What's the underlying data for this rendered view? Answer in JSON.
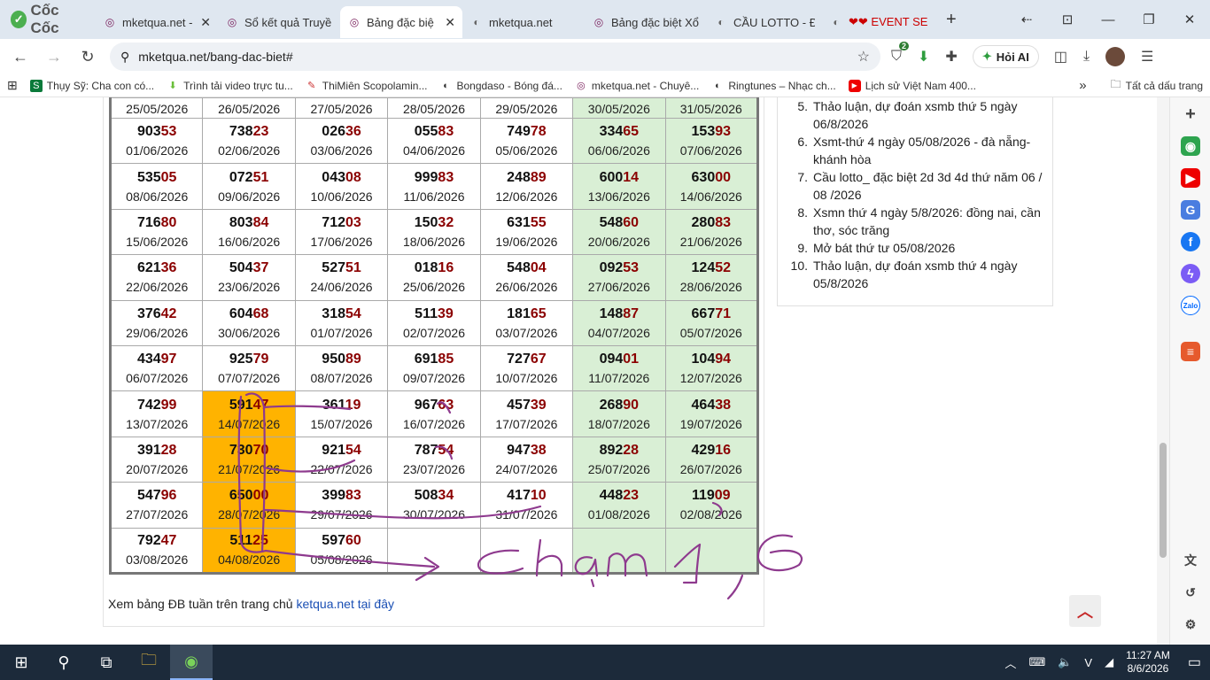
{
  "browser": {
    "brand": "Cốc Cốc",
    "tabs": [
      {
        "title": "mketqua.net - Ch",
        "active": false
      },
      {
        "title": "Sổ kết quả Truyề",
        "active": false
      },
      {
        "title": "Bảng đặc biệ",
        "active": true
      },
      {
        "title": "mketqua.net",
        "active": false
      },
      {
        "title": "Bảng đặc biệt Xổ",
        "active": false
      },
      {
        "title": "CẦU LOTTO - ĐẶ",
        "active": false
      },
      {
        "title": "❤❤ EVENT SE",
        "active": false
      }
    ],
    "url": "mketqua.net/bang-dac-biet#",
    "extension_badge": "2",
    "hoi_ai_label": "Hỏi AI"
  },
  "bookmarks": {
    "items": [
      "Thụy Sỹ: Cha con có...",
      "Trình tải video trực tu...",
      "ThiMiên Scopolamin...",
      "Bongdaso - Bóng đá...",
      "mketqua.net - Chuyê...",
      "Ringtunes – Nhạc ch...",
      "Lịch sử Việt Nam 400..."
    ],
    "more": "»",
    "all": "Tất cả dấu trang"
  },
  "table": {
    "top_dates": [
      "25/05/2026",
      "26/05/2026",
      "27/05/2026",
      "28/05/2026",
      "29/05/2026",
      "30/05/2026",
      "31/05/2026"
    ],
    "rows": [
      [
        {
          "p": "903",
          "s": "53",
          "d": "01/06/2026"
        },
        {
          "p": "738",
          "s": "23",
          "d": "02/06/2026"
        },
        {
          "p": "026",
          "s": "36",
          "d": "03/06/2026"
        },
        {
          "p": "055",
          "s": "83",
          "d": "04/06/2026"
        },
        {
          "p": "749",
          "s": "78",
          "d": "05/06/2026"
        },
        {
          "p": "334",
          "s": "65",
          "d": "06/06/2026"
        },
        {
          "p": "153",
          "s": "93",
          "d": "07/06/2026"
        }
      ],
      [
        {
          "p": "535",
          "s": "05",
          "d": "08/06/2026"
        },
        {
          "p": "072",
          "s": "51",
          "d": "09/06/2026"
        },
        {
          "p": "043",
          "s": "08",
          "d": "10/06/2026"
        },
        {
          "p": "999",
          "s": "83",
          "d": "11/06/2026"
        },
        {
          "p": "248",
          "s": "89",
          "d": "12/06/2026"
        },
        {
          "p": "600",
          "s": "14",
          "d": "13/06/2026"
        },
        {
          "p": "630",
          "s": "00",
          "d": "14/06/2026"
        }
      ],
      [
        {
          "p": "716",
          "s": "80",
          "d": "15/06/2026"
        },
        {
          "p": "803",
          "s": "84",
          "d": "16/06/2026"
        },
        {
          "p": "712",
          "s": "03",
          "d": "17/06/2026"
        },
        {
          "p": "150",
          "s": "32",
          "d": "18/06/2026"
        },
        {
          "p": "631",
          "s": "55",
          "d": "19/06/2026"
        },
        {
          "p": "548",
          "s": "60",
          "d": "20/06/2026"
        },
        {
          "p": "280",
          "s": "83",
          "d": "21/06/2026"
        }
      ],
      [
        {
          "p": "621",
          "s": "36",
          "d": "22/06/2026"
        },
        {
          "p": "504",
          "s": "37",
          "d": "23/06/2026"
        },
        {
          "p": "527",
          "s": "51",
          "d": "24/06/2026"
        },
        {
          "p": "018",
          "s": "16",
          "d": "25/06/2026"
        },
        {
          "p": "548",
          "s": "04",
          "d": "26/06/2026"
        },
        {
          "p": "092",
          "s": "53",
          "d": "27/06/2026"
        },
        {
          "p": "124",
          "s": "52",
          "d": "28/06/2026"
        }
      ],
      [
        {
          "p": "376",
          "s": "42",
          "d": "29/06/2026"
        },
        {
          "p": "604",
          "s": "68",
          "d": "30/06/2026"
        },
        {
          "p": "318",
          "s": "54",
          "d": "01/07/2026"
        },
        {
          "p": "511",
          "s": "39",
          "d": "02/07/2026"
        },
        {
          "p": "181",
          "s": "65",
          "d": "03/07/2026"
        },
        {
          "p": "148",
          "s": "87",
          "d": "04/07/2026"
        },
        {
          "p": "667",
          "s": "71",
          "d": "05/07/2026"
        }
      ],
      [
        {
          "p": "434",
          "s": "97",
          "d": "06/07/2026"
        },
        {
          "p": "925",
          "s": "79",
          "d": "07/07/2026"
        },
        {
          "p": "950",
          "s": "89",
          "d": "08/07/2026"
        },
        {
          "p": "691",
          "s": "85",
          "d": "09/07/2026"
        },
        {
          "p": "727",
          "s": "67",
          "d": "10/07/2026"
        },
        {
          "p": "094",
          "s": "01",
          "d": "11/07/2026"
        },
        {
          "p": "104",
          "s": "94",
          "d": "12/07/2026"
        }
      ],
      [
        {
          "p": "742",
          "s": "99",
          "d": "13/07/2026"
        },
        {
          "p": "591",
          "s": "47",
          "d": "14/07/2026",
          "hl": true
        },
        {
          "p": "361",
          "s": "19",
          "d": "15/07/2026"
        },
        {
          "p": "967",
          "s": "63",
          "d": "16/07/2026"
        },
        {
          "p": "457",
          "s": "39",
          "d": "17/07/2026"
        },
        {
          "p": "268",
          "s": "90",
          "d": "18/07/2026"
        },
        {
          "p": "464",
          "s": "38",
          "d": "19/07/2026"
        }
      ],
      [
        {
          "p": "391",
          "s": "28",
          "d": "20/07/2026"
        },
        {
          "p": "730",
          "s": "70",
          "d": "21/07/2026",
          "hl": true
        },
        {
          "p": "921",
          "s": "54",
          "d": "22/07/2026"
        },
        {
          "p": "787",
          "s": "54",
          "d": "23/07/2026"
        },
        {
          "p": "947",
          "s": "38",
          "d": "24/07/2026"
        },
        {
          "p": "892",
          "s": "28",
          "d": "25/07/2026"
        },
        {
          "p": "429",
          "s": "16",
          "d": "26/07/2026"
        }
      ],
      [
        {
          "p": "547",
          "s": "96",
          "d": "27/07/2026"
        },
        {
          "p": "650",
          "s": "00",
          "d": "28/07/2026",
          "hl": true
        },
        {
          "p": "399",
          "s": "83",
          "d": "29/07/2026"
        },
        {
          "p": "508",
          "s": "34",
          "d": "30/07/2026"
        },
        {
          "p": "417",
          "s": "10",
          "d": "31/07/2026"
        },
        {
          "p": "448",
          "s": "23",
          "d": "01/08/2026"
        },
        {
          "p": "119",
          "s": "09",
          "d": "02/08/2026"
        }
      ],
      [
        {
          "p": "792",
          "s": "47",
          "d": "03/08/2026"
        },
        {
          "p": "511",
          "s": "25",
          "d": "04/08/2026",
          "hl": true
        },
        {
          "p": "597",
          "s": "60",
          "d": "05/08/2026"
        },
        {
          "p": "",
          "s": "",
          "d": ""
        },
        {
          "p": "",
          "s": "",
          "d": ""
        },
        {
          "p": "",
          "s": "",
          "d": ""
        },
        {
          "p": "",
          "s": "",
          "d": ""
        }
      ]
    ]
  },
  "footnote": {
    "text": "Xem bảng ĐB tuần trên trang chủ ",
    "link": "ketqua.net tại đây"
  },
  "news": [
    {
      "n": "5.",
      "t": "Thảo luận, dự đoán xsmb thứ 5 ngày 06/8/2026"
    },
    {
      "n": "6.",
      "t": "Xsmt-thứ 4 ngày 05/08/2026 - đà nẵng- khánh hòa"
    },
    {
      "n": "7.",
      "t": "Cầu lotto_ đặc biệt 2d 3d 4d thứ năm 06 / 08 /2026"
    },
    {
      "n": "8.",
      "t": "Xsmn thứ 4 ngày 5/8/2026: đồng nai, cần thơ, sóc trăng"
    },
    {
      "n": "9.",
      "t": "Mở bát thứ tư 05/08/2026"
    },
    {
      "n": "10.",
      "t": "Thảo luận, dự đoán xsmb thứ 4 ngày 05/8/2026"
    }
  ],
  "taskbar": {
    "time": "11:27 AM",
    "date": "8/6/2026"
  },
  "colors": {
    "weekend_bg": "#d9efd5",
    "highlight_bg": "#ffb300",
    "tail_red": "#8b0000",
    "ink": "#8e3a8e"
  }
}
